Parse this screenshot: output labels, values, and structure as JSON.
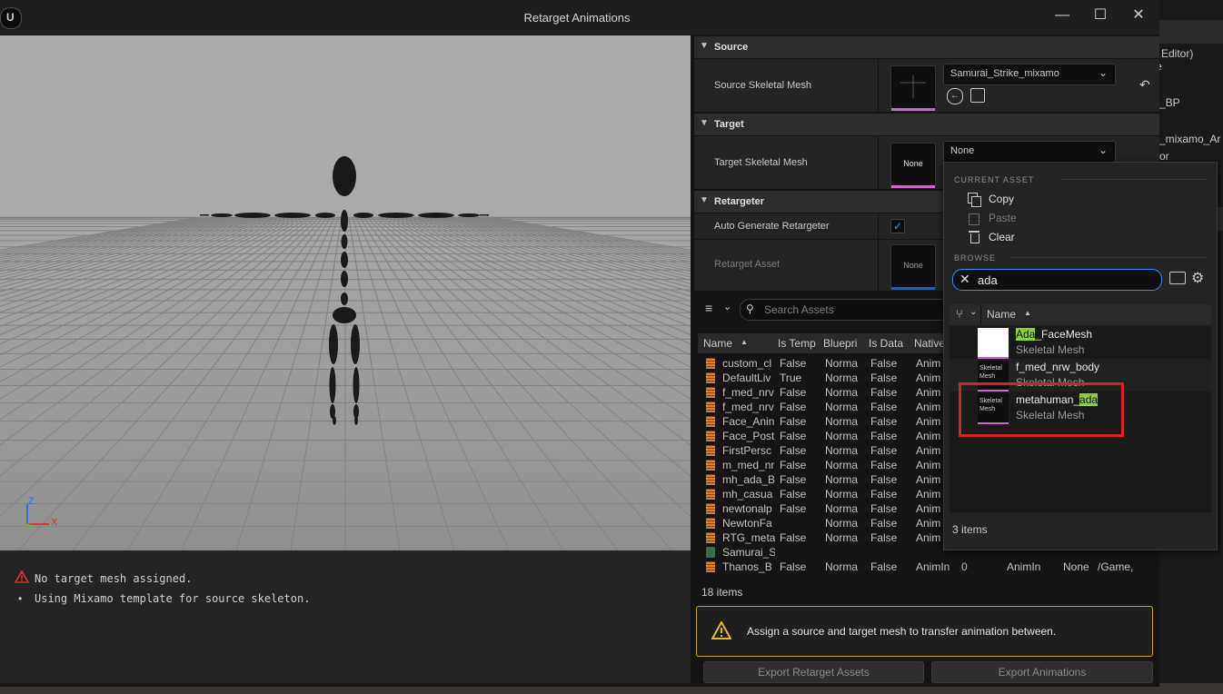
{
  "background_editor": {
    "texts": [
      "Editor)",
      "e",
      "_BP",
      "_mixamo_Ar",
      "or"
    ]
  },
  "window": {
    "title": "Retarget Animations",
    "controls": {
      "minimize": "—",
      "maximize": "☐",
      "close": "✕"
    }
  },
  "viewport": {
    "axis_z": "Z",
    "axis_x": "X"
  },
  "log": {
    "messages": [
      {
        "type": "error",
        "text": "No target mesh assigned."
      },
      {
        "type": "info",
        "text": "Using Mixamo template for source skeleton."
      }
    ]
  },
  "details": {
    "source_section": "Source",
    "source_mesh_label": "Source Skeletal Mesh",
    "source_mesh_value": "Samurai_Strike_mixamo",
    "target_section": "Target",
    "target_mesh_label": "Target Skeletal Mesh",
    "target_mesh_value": "None",
    "target_thumb_text": "None",
    "retargeter_section": "Retargeter",
    "auto_generate_label": "Auto Generate Retargeter",
    "auto_generate_checked": true,
    "retarget_asset_label": "Retarget Asset",
    "retarget_thumb_text": "None"
  },
  "asset_browser": {
    "search_placeholder": "Search Assets",
    "columns": [
      "Name",
      "Is Temp",
      "Bluepri",
      "Is Data",
      "Native"
    ],
    "rows": [
      {
        "name": "custom_cl",
        "is_temp": "False",
        "blueprint": "Norma",
        "is_data": "False",
        "native": "Anim"
      },
      {
        "name": "DefaultLiv",
        "is_temp": "True",
        "blueprint": "Norma",
        "is_data": "False",
        "native": "Anim"
      },
      {
        "name": "f_med_nrv",
        "is_temp": "False",
        "blueprint": "Norma",
        "is_data": "False",
        "native": "Anim"
      },
      {
        "name": "f_med_nrv",
        "is_temp": "False",
        "blueprint": "Norma",
        "is_data": "False",
        "native": "Anim"
      },
      {
        "name": "Face_Anin",
        "is_temp": "False",
        "blueprint": "Norma",
        "is_data": "False",
        "native": "Anim"
      },
      {
        "name": "Face_Post",
        "is_temp": "False",
        "blueprint": "Norma",
        "is_data": "False",
        "native": "Anim"
      },
      {
        "name": "FirstPersc",
        "is_temp": "False",
        "blueprint": "Norma",
        "is_data": "False",
        "native": "Anim"
      },
      {
        "name": "m_med_nr",
        "is_temp": "False",
        "blueprint": "Norma",
        "is_data": "False",
        "native": "Anim"
      },
      {
        "name": "mh_ada_B",
        "is_temp": "False",
        "blueprint": "Norma",
        "is_data": "False",
        "native": "Anim"
      },
      {
        "name": "mh_casua",
        "is_temp": "False",
        "blueprint": "Norma",
        "is_data": "False",
        "native": "Anim"
      },
      {
        "name": "newtonalp",
        "is_temp": "False",
        "blueprint": "Norma",
        "is_data": "False",
        "native": "Anim"
      },
      {
        "name": "NewtonFa",
        "is_temp": "",
        "blueprint": "Norma",
        "is_data": "False",
        "native": "Anim"
      },
      {
        "name": "RTG_meta",
        "is_temp": "False",
        "blueprint": "Norma",
        "is_data": "False",
        "native": "Anim"
      },
      {
        "name": "Samurai_S",
        "is_temp": "",
        "blueprint": "",
        "is_data": "",
        "native": ""
      },
      {
        "name": "Thanos_B",
        "is_temp": "False",
        "blueprint": "Norma",
        "is_data": "False",
        "native": "AnimIn",
        "extra1": "0",
        "extra2": "AnimIn",
        "extra3": "None",
        "extra4": "/Game,"
      }
    ],
    "count": "18 items"
  },
  "warning": {
    "text": "Assign a source and target mesh to transfer animation between."
  },
  "buttons": {
    "export_retarget": "Export Retarget Assets",
    "export_animations": "Export Animations"
  },
  "popup": {
    "current_asset_label": "CURRENT ASSET",
    "copy": "Copy",
    "paste": "Paste",
    "clear": "Clear",
    "browse_label": "BROWSE",
    "search_value": "ada",
    "name_header": "Name",
    "items": [
      {
        "prefix": "",
        "highlight": "Ada",
        "suffix": "_FaceMesh",
        "type": "Skeletal Mesh",
        "thumb": ""
      },
      {
        "prefix": "f_med_nrw_body",
        "highlight": "",
        "suffix": "",
        "type": "Skeletal Mesh",
        "thumb": "Skeletal Mesh"
      },
      {
        "prefix": "metahuman_",
        "highlight": "ada",
        "suffix": "",
        "type": "Skeletal Mesh",
        "thumb": "Skeletal Mesh"
      }
    ],
    "count": "3 items"
  },
  "colors": {
    "highlight_box": "#d6202a",
    "search_highlight": "#8fce3a",
    "thumb_accent": "#c96ac9",
    "checkbox": "#1a6fd6",
    "warning_border": "#c9a21c"
  }
}
